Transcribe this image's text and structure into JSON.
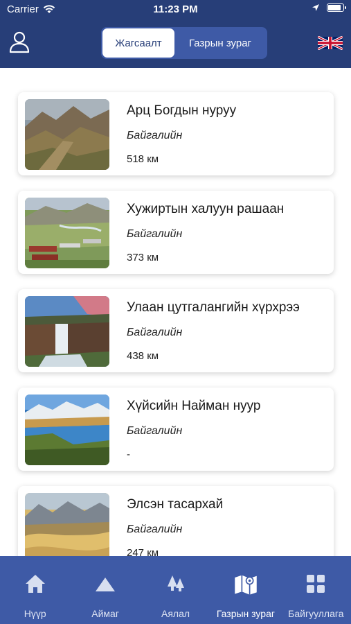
{
  "status_bar": {
    "carrier": "Carrier",
    "time": "11:23 PM"
  },
  "header": {
    "segments": [
      {
        "label": "Жагсаалт",
        "active": true
      },
      {
        "label": "Газрын зураг",
        "active": false
      }
    ],
    "user_icon": "user-icon",
    "language_icon": "uk-flag-icon"
  },
  "places": [
    {
      "title": "Арц Богдын нуруу",
      "category": "Байгалийн",
      "distance": "518 км",
      "image": "mountain-valley"
    },
    {
      "title": "Хужиртын халуун рашаан",
      "category": "Байгалийн",
      "distance": "373 км",
      "image": "resort-valley"
    },
    {
      "title": "Улаан цутгалангийн хүрхрээ",
      "category": "Байгалийн",
      "distance": "438 км",
      "image": "waterfall"
    },
    {
      "title": "Хүйсийн Найман нуур",
      "category": "Байгалийн",
      "distance": "-",
      "image": "lake"
    },
    {
      "title": "Элсэн тасархай",
      "category": "Байгалийн",
      "distance": "247 км",
      "image": "sand-dunes"
    }
  ],
  "tabbar": {
    "tabs": [
      {
        "label": "Нүүр",
        "icon": "home-icon"
      },
      {
        "label": "Аймаг",
        "icon": "mountain-icon"
      },
      {
        "label": "Аялал",
        "icon": "trees-icon"
      },
      {
        "label": "Газрын зураг",
        "icon": "map-icon"
      },
      {
        "label": "Байгууллага",
        "icon": "grid-icon"
      }
    ],
    "active_index": 3
  },
  "colors": {
    "header_bg": "#273e78",
    "segment_bg": "#3e5aa6",
    "tabbar_bg": "#3e5aa6"
  }
}
